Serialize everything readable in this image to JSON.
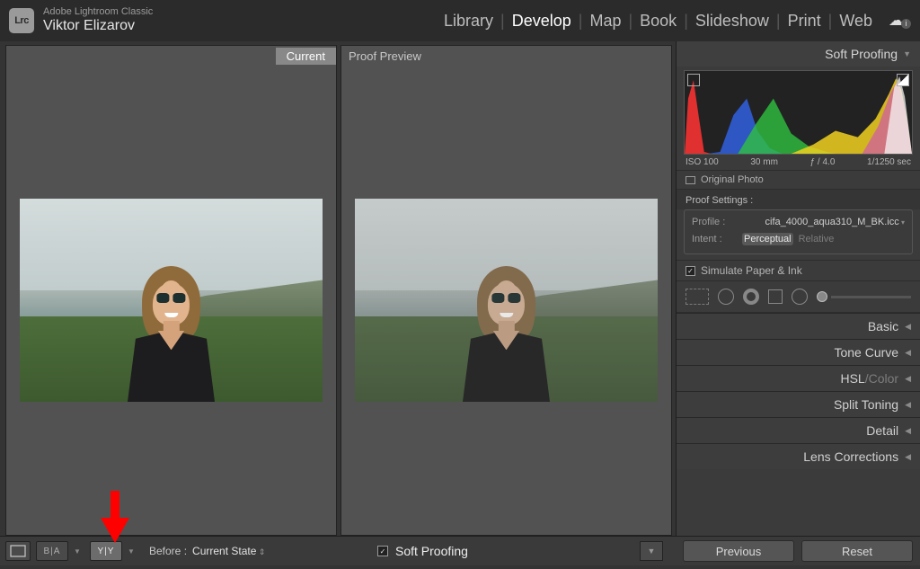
{
  "app": {
    "logo_text": "Lrc",
    "name": "Adobe Lightroom Classic",
    "identity": "Viktor Elizarov"
  },
  "modules": [
    {
      "label": "Library",
      "active": false
    },
    {
      "label": "Develop",
      "active": true
    },
    {
      "label": "Map",
      "active": false
    },
    {
      "label": "Book",
      "active": false
    },
    {
      "label": "Slideshow",
      "active": false
    },
    {
      "label": "Print",
      "active": false
    },
    {
      "label": "Web",
      "active": false
    }
  ],
  "compare": {
    "left_label": "Current",
    "right_label": "Proof Preview"
  },
  "right_panel": {
    "header": "Soft Proofing",
    "hist_meta": {
      "iso": "ISO 100",
      "focal": "30 mm",
      "aperture": "ƒ / 4.0",
      "shutter": "1/1250 sec"
    },
    "original_link": "Original Photo",
    "proof_settings_title": "Proof Settings :",
    "profile_label": "Profile :",
    "profile_value": "cifa_4000_aqua310_M_BK.icc",
    "intent_label": "Intent :",
    "intent_perceptual": "Perceptual",
    "intent_relative": "Relative",
    "simulate_label": "Simulate Paper & Ink",
    "sections": {
      "basic": "Basic",
      "tone_curve": "Tone Curve",
      "hsl_before": "HSL",
      "hsl_sep": " / ",
      "hsl_after": "Color",
      "split_toning": "Split Toning",
      "detail": "Detail",
      "lens": "Lens Corrections"
    }
  },
  "bottom": {
    "view_ba_text": "B|A",
    "view_yy_text": "Y|Y",
    "before_label": "Before :",
    "before_value": "Current State",
    "soft_proof_label": "Soft Proofing",
    "btn_previous": "Previous",
    "btn_reset": "Reset"
  }
}
